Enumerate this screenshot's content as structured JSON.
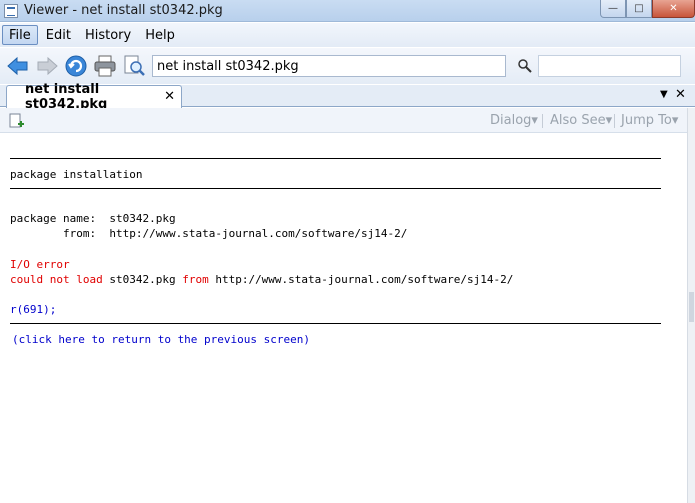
{
  "window": {
    "title": "Viewer - net install st0342.pkg",
    "controls": {
      "minimize": "—",
      "maximize": "□",
      "close": "✕"
    }
  },
  "menu": {
    "items": [
      "File",
      "Edit",
      "History",
      "Help"
    ]
  },
  "toolbar": {
    "command_value": "net install st0342.pkg",
    "search_value": ""
  },
  "tabs": {
    "active_label": "net install st0342.pkg",
    "close_glyph": "✕",
    "menu_glyph": "▼",
    "close_all_glyph": "✕"
  },
  "viewer_bar": {
    "dialog": "Dialog",
    "also_see": "Also See",
    "jump_to": "Jump To",
    "dropdown_glyph": "▾"
  },
  "content": {
    "heading": "package installation",
    "name_label": "package name:",
    "name_value": "st0342.pkg",
    "from_label": "from:",
    "from_value": "http://www.stata-journal.com/software/sj14-2/",
    "error_title": "I/O error",
    "error_prefix": "could not load",
    "error_pkg": "st0342.pkg",
    "error_from": "from",
    "error_url": "http://www.stata-journal.com/software/sj14-2/",
    "return_code": "r(691);",
    "back_link": "(click here to return to the previous screen)"
  },
  "colors": {
    "error": "#e00000",
    "link": "#0000cc"
  }
}
